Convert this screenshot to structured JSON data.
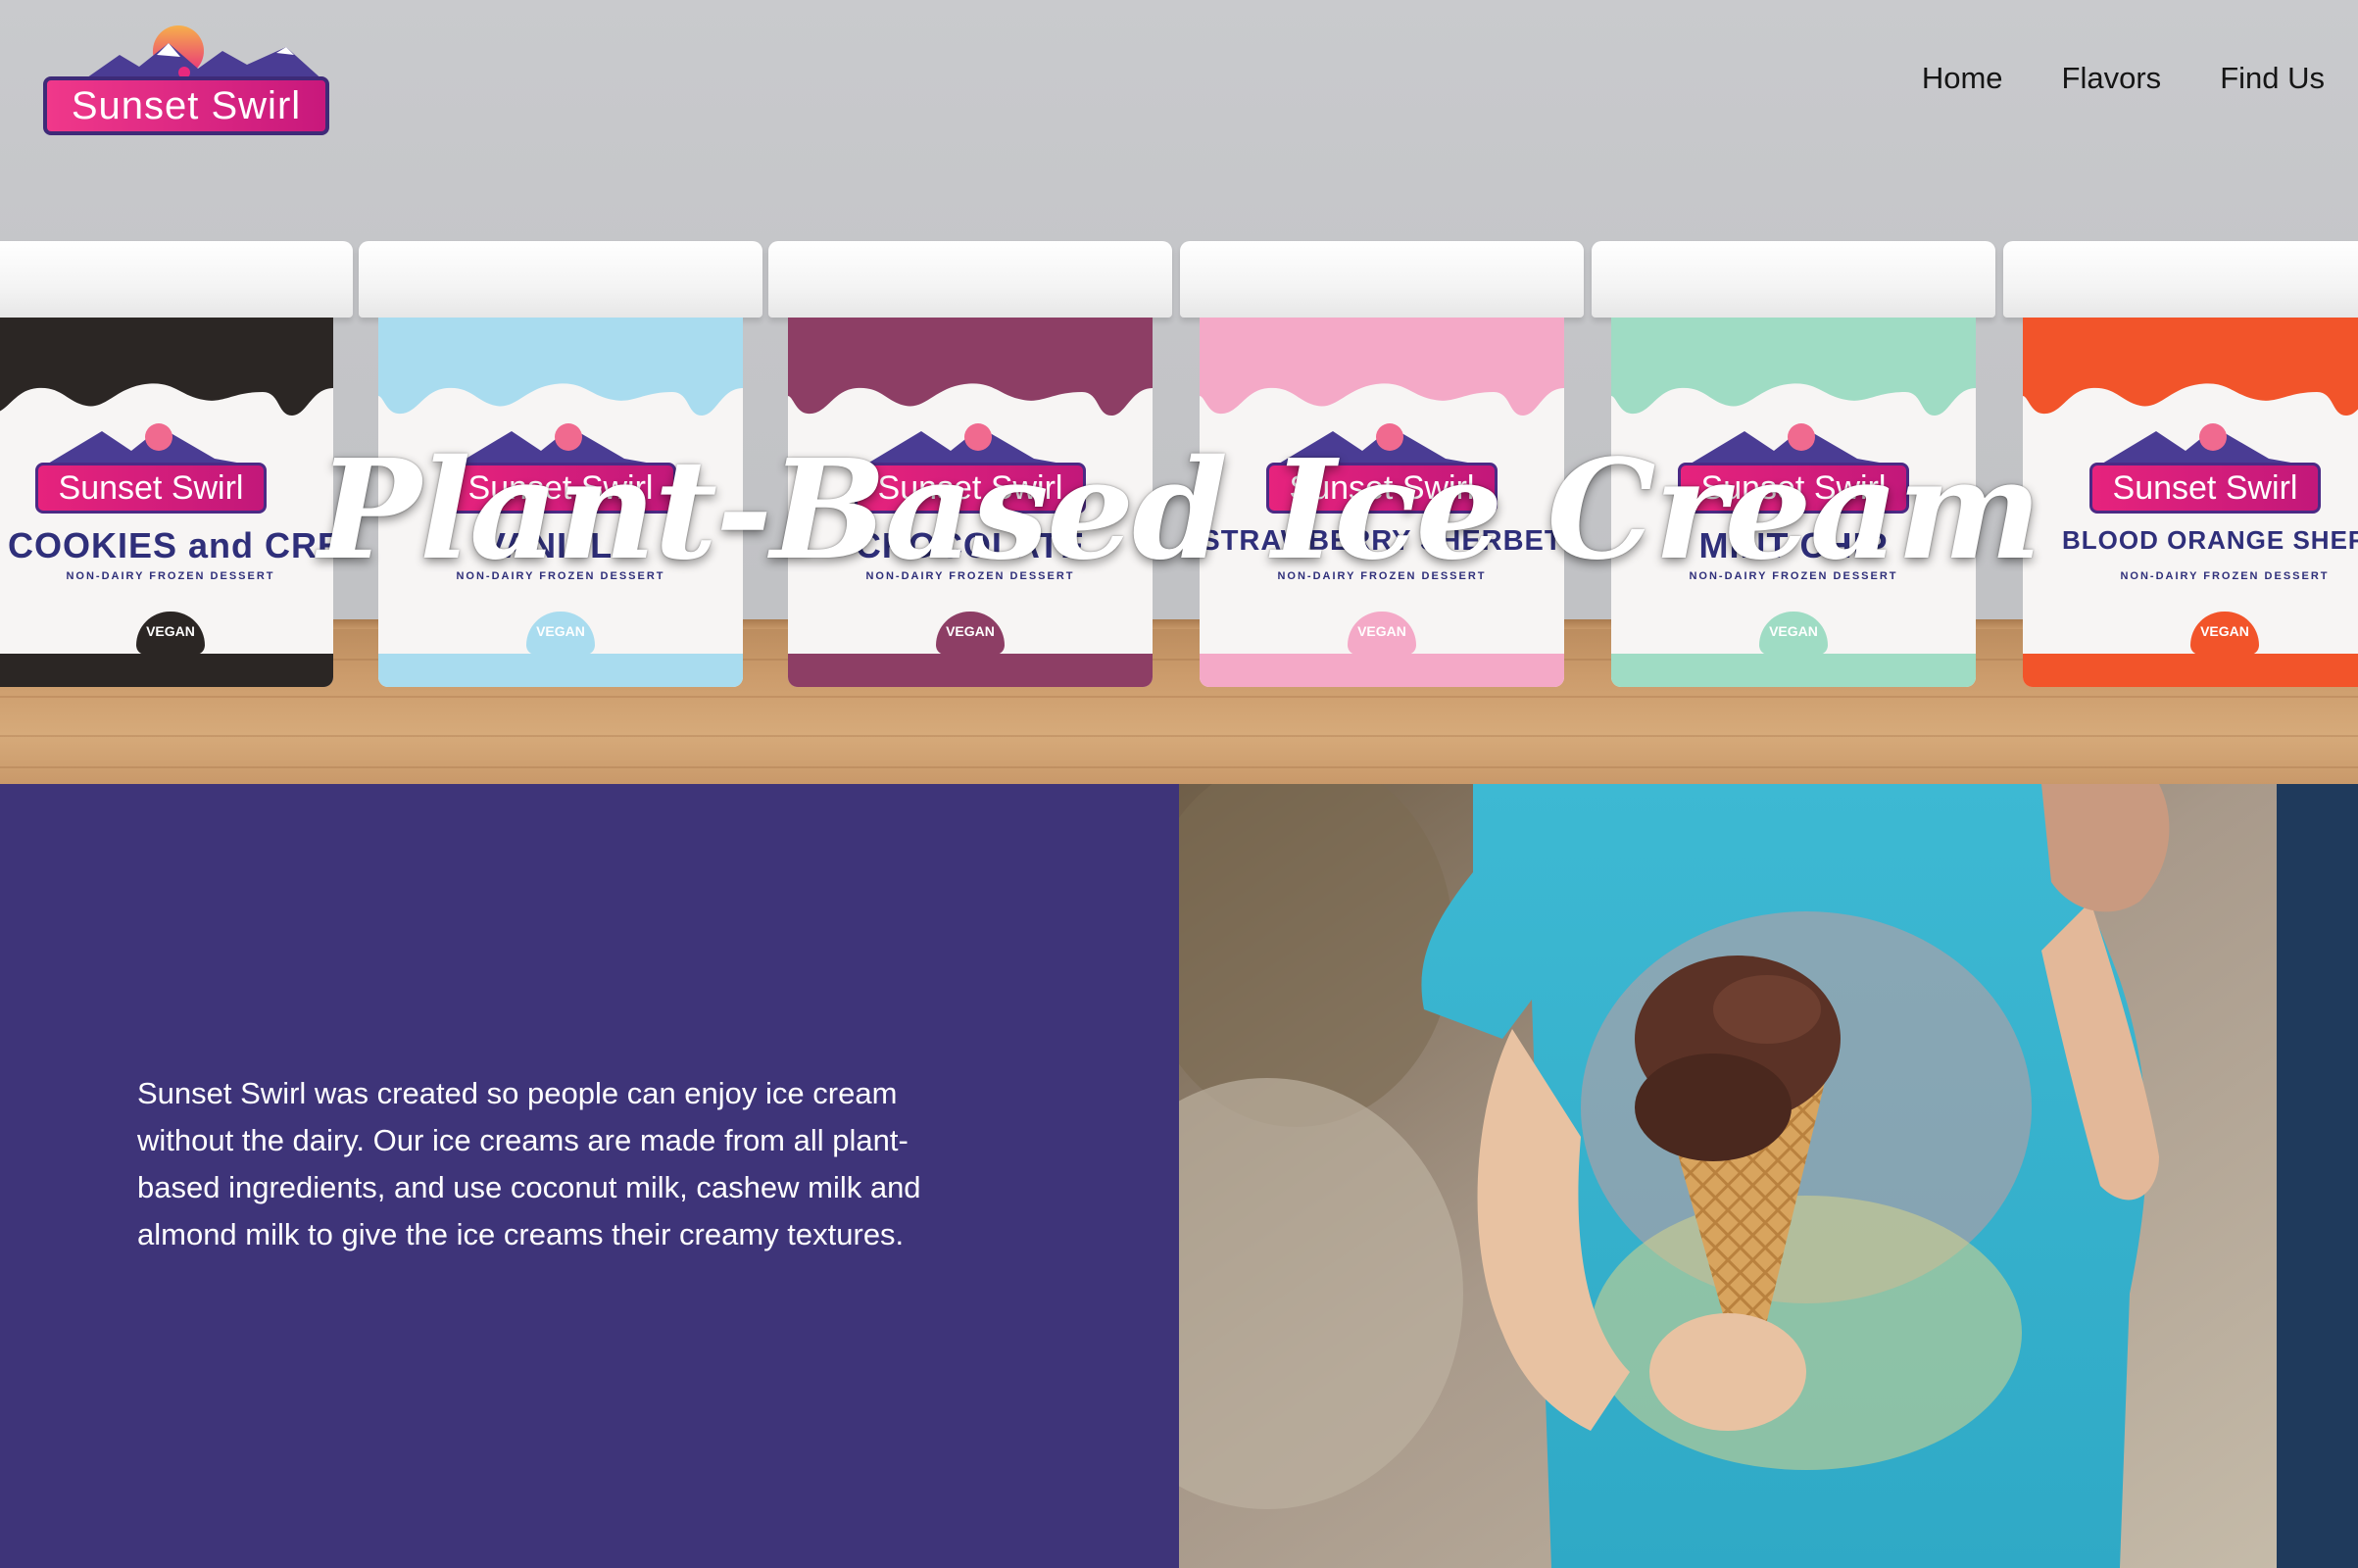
{
  "brand": {
    "name": "Sunset Swirl"
  },
  "nav": {
    "items": [
      {
        "label": "Home"
      },
      {
        "label": "Flavors"
      },
      {
        "label": "Find Us"
      }
    ]
  },
  "hero": {
    "title": "Plant-Based Ice Cream",
    "pints": [
      {
        "flavor": "COOKIES and CREAM",
        "color": "#2b2624",
        "vegan_label": "VEGAN",
        "sub": "NON-DAIRY FROZEN DESSERT",
        "brand": "Sunset Swirl"
      },
      {
        "flavor": "VANILLA",
        "color": "#a9dcef",
        "vegan_label": "VEGAN",
        "sub": "NON-DAIRY FROZEN DESSERT",
        "brand": "Sunset Swirl"
      },
      {
        "flavor": "CHOCOLATE",
        "color": "#8d3e65",
        "vegan_label": "VEGAN",
        "sub": "NON-DAIRY FROZEN DESSERT",
        "brand": "Sunset Swirl"
      },
      {
        "flavor": "STRAWBERRY SHERBET",
        "color": "#f4a9c7",
        "vegan_label": "VEGAN",
        "sub": "NON-DAIRY FROZEN DESSERT",
        "brand": "Sunset Swirl"
      },
      {
        "flavor": "MINT CHIP",
        "color": "#9fdcc4",
        "vegan_label": "VEGAN",
        "sub": "NON-DAIRY FROZEN DESSERT",
        "brand": "Sunset Swirl"
      },
      {
        "flavor": "BLOOD ORANGE SHERBET",
        "color": "#f2542a",
        "vegan_label": "VEGAN",
        "sub": "NON-DAIRY FROZEN DESSERT",
        "brand": "Sunset Swirl"
      }
    ]
  },
  "about": {
    "text": "Sunset Swirl was created so people can enjoy ice cream without the dairy. Our ice creams are made from all plant-based ingredients, and use coconut milk, cashew milk and almond milk to give the ice creams their creamy textures."
  },
  "colors": {
    "about_bg": "#3e3479",
    "logo_pink": "#e6237d",
    "logo_purple": "#3e2a78"
  }
}
